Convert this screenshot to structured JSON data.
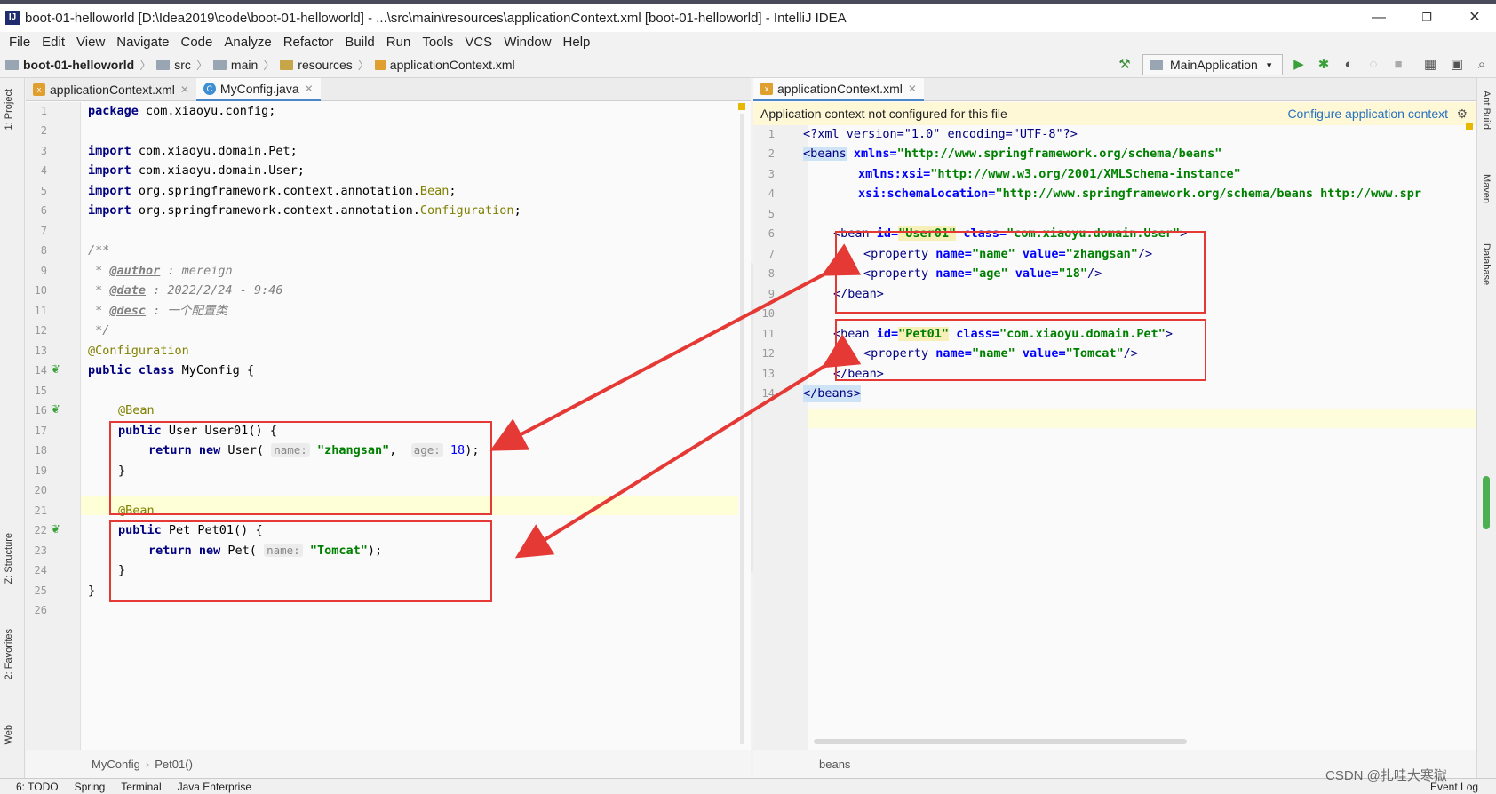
{
  "window": {
    "title": "boot-01-helloworld [D:\\Idea2019\\code\\boot-01-helloworld] - ...\\src\\main\\resources\\applicationContext.xml [boot-01-helloworld] - IntelliJ IDEA",
    "minimize": "—",
    "restore": "❐",
    "close": "✕"
  },
  "menu": [
    "File",
    "Edit",
    "View",
    "Navigate",
    "Code",
    "Analyze",
    "Refactor",
    "Build",
    "Run",
    "Tools",
    "VCS",
    "Window",
    "Help"
  ],
  "breadcrumb": [
    "boot-01-helloworld",
    "src",
    "main",
    "resources",
    "applicationContext.xml"
  ],
  "run_config": "MainApplication",
  "left_strip": {
    "project": "1: Project",
    "structure": "Z: Structure",
    "favorites": "2: Favorites",
    "web": "Web"
  },
  "right_strip": {
    "ant": "Ant Build",
    "maven": "Maven",
    "database": "Database"
  },
  "left_editor": {
    "tabs": [
      {
        "label": "applicationContext.xml",
        "icon": "xml-file-icon"
      },
      {
        "label": "MyConfig.java",
        "icon": "java-class-icon"
      }
    ],
    "line_numbers": [
      "1",
      "2",
      "3",
      "4",
      "5",
      "6",
      "7",
      "8",
      "9",
      "10",
      "11",
      "12",
      "13",
      "14",
      "15",
      "16",
      "17",
      "18",
      "19",
      "20",
      "21",
      "22",
      "23",
      "24",
      "25",
      "26"
    ],
    "code": {
      "l1_kw": "package",
      "l1_rest": " com.xiaoyu.config;",
      "l3_kw": "import",
      "l3_rest": " com.xiaoyu.domain.Pet;",
      "l4_kw": "import",
      "l4_rest": " com.xiaoyu.domain.User;",
      "l5_kw": "import",
      "l5_rest": " org.springframework.context.annotation.",
      "l5_cls": "Bean",
      "l5_end": ";",
      "l6_kw": "import",
      "l6_rest": " org.springframework.context.annotation.",
      "l6_cls": "Configuration",
      "l6_end": ";",
      "l8": "/**",
      "l9_pre": " * ",
      "l9_tag": "@author",
      "l9_rest": " : mereign",
      "l10_pre": " * ",
      "l10_tag": "@date",
      "l10_rest": " : 2022/2/24 - 9:46",
      "l11_pre": " * ",
      "l11_tag": "@desc",
      "l11_rest": " : 一个配置类",
      "l12": " */",
      "l13": "@Configuration",
      "l14_kw": "public class",
      "l14_rest": " MyConfig {",
      "l16": "@Bean",
      "l17_kw": "public",
      "l17_rest": " User User01() {",
      "l18_kw": "return new",
      "l18_rest": " User(",
      "l18_h1": "name:",
      "l18_s": "\"zhangsan\"",
      "l18_c": ", ",
      "l18_h2": "age:",
      "l18_n": "18",
      "l18_end": ");",
      "l19": "}",
      "l21": "@Bean",
      "l22_kw": "public",
      "l22_rest": " Pet Pet01() {",
      "l23_kw": "return new",
      "l23_rest": " Pet(",
      "l23_h": "name:",
      "l23_s": "\"Tomcat\"",
      "l23_end": ");",
      "l24": "}",
      "l25": "}"
    },
    "breadcrumb": [
      "MyConfig",
      "Pet01()"
    ]
  },
  "right_editor": {
    "tabs": [
      {
        "label": "applicationContext.xml",
        "icon": "xml-file-icon"
      }
    ],
    "banner": "Application context not configured for this file",
    "banner_action": "Configure application context",
    "line_numbers": [
      "1",
      "2",
      "3",
      "4",
      "5",
      "6",
      "7",
      "8",
      "9",
      "10",
      "11",
      "12",
      "13",
      "14"
    ],
    "code": {
      "l1": "<?xml version=\"1.0\" encoding=\"UTF-8\"?>",
      "l2_tag": "<beans",
      "l2_attr": " xmlns=",
      "l2_val": "\"http://www.springframework.org/schema/beans\"",
      "l3_attr": "xmlns:xsi=",
      "l3_val": "\"http://www.w3.org/2001/XMLSchema-instance\"",
      "l4_attr": "xsi:schemaLocation=",
      "l4_val": "\"http://www.springframework.org/schema/beans http://www.spr",
      "l6_tag": "<bean",
      "l6_a1": " id=",
      "l6_v1": "\"User01\"",
      "l6_a2": " class=",
      "l6_v2": "\"com.xiaoyu.domain.User\"",
      "l6_end": ">",
      "l7_tag": "<property",
      "l7_a1": " name=",
      "l7_v1": "\"name\"",
      "l7_a2": " value=",
      "l7_v2": "\"zhangsan\"",
      "l7_end": "/>",
      "l8_tag": "<property",
      "l8_a1": " name=",
      "l8_v1": "\"age\"",
      "l8_a2": " value=",
      "l8_v2": "\"18\"",
      "l8_end": "/>",
      "l9": "</bean>",
      "l11_tag": "<bean",
      "l11_a1": " id=",
      "l11_v1": "\"Pet01\"",
      "l11_a2": " class=",
      "l11_v2": "\"com.xiaoyu.domain.Pet\"",
      "l11_end": ">",
      "l12_tag": "<property",
      "l12_a1": " name=",
      "l12_v1": "\"name\"",
      "l12_a2": " value=",
      "l12_v2": "\"Tomcat\"",
      "l12_end": "/>",
      "l13": "</bean>",
      "l14": "</beans>"
    },
    "breadcrumb": [
      "beans"
    ]
  },
  "statusbar": {
    "todo": "6: TODO",
    "spring": "Spring",
    "terminal": "Terminal",
    "javaee": "Java Enterprise",
    "eventlog": "Event Log"
  },
  "watermark": "CSDN @扎哇大寒獄",
  "colors": {
    "highlight_box": "#e53935",
    "arrow": "#e53935",
    "link": "#2470c2"
  }
}
